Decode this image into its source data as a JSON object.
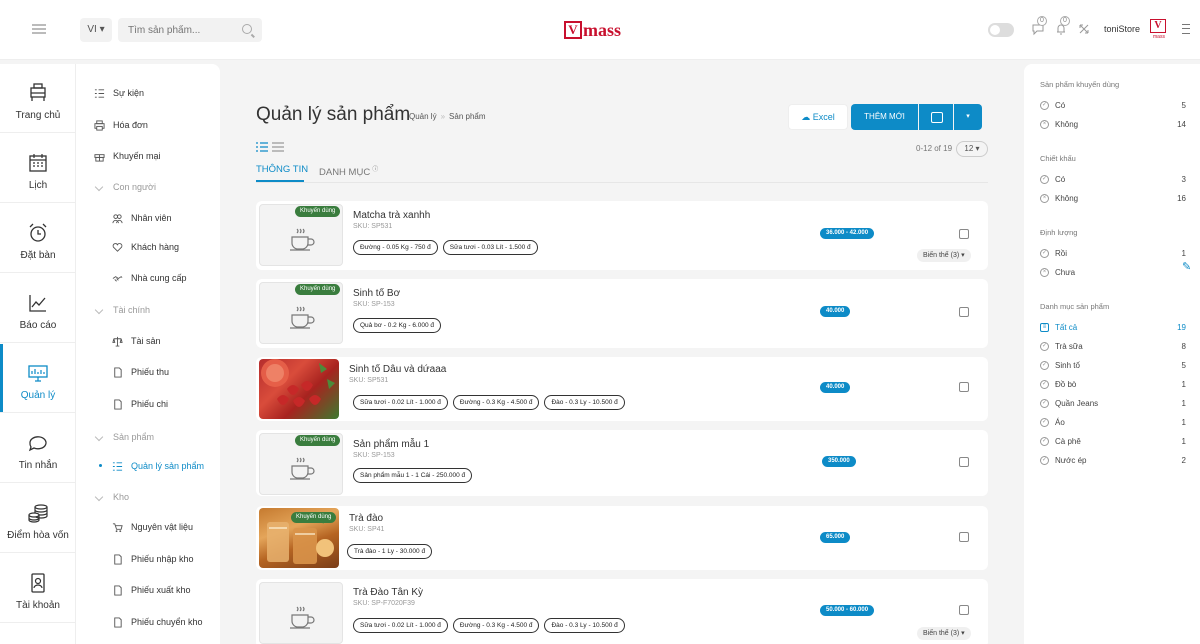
{
  "topbar": {
    "lang": "VI ▾",
    "search_placeholder": "Tìm sản phẩm...",
    "logo_mark": "V",
    "logo_text": "mass",
    "notif_badge_1": "0",
    "notif_badge_2": "0",
    "store_name": "toniStore",
    "avatar_mark": "V",
    "avatar_text": "mass"
  },
  "leftnav": [
    {
      "label": "Trang chủ",
      "icon": "home-icon"
    },
    {
      "label": "Lịch",
      "icon": "calendar-icon"
    },
    {
      "label": "Đặt bàn",
      "icon": "alarm-clock-icon"
    },
    {
      "label": "Báo cáo",
      "icon": "chart-icon"
    },
    {
      "label": "Quản lý",
      "icon": "monitor-icon"
    },
    {
      "label": "Tin nhắn",
      "icon": "chat-icon"
    },
    {
      "label": "Điểm hòa vốn",
      "icon": "coins-icon"
    },
    {
      "label": "Tài khoản",
      "icon": "account-icon"
    }
  ],
  "subnav": {
    "su_kien": "Sự kiện",
    "hoa_don": "Hóa đơn",
    "khuyen_mai": "Khuyến mại",
    "con_nguoi": "Con người",
    "nhan_vien": "Nhân viên",
    "khach_hang": "Khách hàng",
    "nha_cung_cap": "Nhà cung cấp",
    "tai_chinh": "Tài chính",
    "tai_san": "Tài sản",
    "phieu_thu": "Phiếu thu",
    "phieu_chi": "Phiếu chi",
    "san_pham": "Sản phẩm",
    "quan_ly_san_pham": "Quản lý sản phẩm",
    "kho": "Kho",
    "nguyen_vat_lieu": "Nguyên vật liệu",
    "phieu_nhap_kho": "Phiếu nhập kho",
    "phieu_xuat_kho": "Phiếu xuất kho",
    "phieu_chuyen_kho": "Phiếu chuyển kho"
  },
  "main": {
    "title": "Quản lý sản phẩm",
    "breadcrumb": [
      "Quản lý",
      "Sản phẩm"
    ],
    "excel_label": "Excel",
    "add_label": "THÊM MỚI",
    "dropdown_caret": "▾",
    "page_info": "0-12 of 19",
    "page_size": "12 ▾",
    "tabs": [
      "THÔNG TIN",
      "DANH MỤC"
    ],
    "tab2_sup": "ⓘ"
  },
  "products": [
    {
      "name": "Matcha trà xanhh",
      "sku": "SKU: SP531",
      "promo": "Khuyến dùng",
      "chips": [
        "Đường - 0.05 Kg - 750 đ",
        "Sữa tươi - 0.03 Lít - 1.500 đ"
      ],
      "price": "36.000 - 42.000",
      "variant": "Biến thể (3) ▾"
    },
    {
      "name": "Sinh tố Bơ",
      "sku": "SKU: SP-153",
      "promo": "Khuyến dùng",
      "chips": [
        "Quả bơ - 0.2 Kg - 6.000 đ"
      ],
      "price": "40.000",
      "variant": ""
    },
    {
      "name": "Sinh tố Dâu và dứaaa",
      "sku": "SKU: SP531",
      "promo": "",
      "chips": [
        "Sữa tươi - 0.02 Lít - 1.000 đ",
        "Đường - 0.3 Kg - 4.500 đ",
        "Đào - 0.3 Ly - 10.500 đ"
      ],
      "price": "40.000",
      "variant": ""
    },
    {
      "name": "Sản phẩm mẫu 1",
      "sku": "SKU: SP-153",
      "promo": "Khuyến dùng",
      "chips": [
        "Sản phẩm mẫu 1 - 1 Cái - 250.000 đ"
      ],
      "price": "350.000",
      "variant": ""
    },
    {
      "name": "Trà đào",
      "sku": "SKU: SP41",
      "promo": "Khuyến dùng",
      "chips": [
        "Trà đào - 1 Ly - 30.000 đ"
      ],
      "price": "65.000",
      "variant": ""
    },
    {
      "name": "Trà Đào Tân Kỳ",
      "sku": "SKU: SP-F7020F39",
      "promo": "",
      "chips": [
        "Sữa tươi - 0.02 Lít - 1.000 đ",
        "Đường - 0.3 Kg - 4.500 đ",
        "Đào - 0.3 Ly - 10.500 đ"
      ],
      "price": "50.000 - 60.000",
      "variant": "Biến thể (3) ▾"
    }
  ],
  "filters": {
    "sec1": "Sản phẩm khuyến dùng",
    "sec1_rows": [
      {
        "label": "Có",
        "count": "5"
      },
      {
        "label": "Không",
        "count": "14"
      }
    ],
    "sec2": "Chiết khấu",
    "sec2_rows": [
      {
        "label": "Có",
        "count": "3"
      },
      {
        "label": "Không",
        "count": "16"
      }
    ],
    "sec3": "Định lượng",
    "sec3_rows": [
      {
        "label": "Rồi",
        "count": "1"
      },
      {
        "label": "Chưa",
        "count": ""
      }
    ],
    "sec4": "Danh mục sản phẩm",
    "sec4_rows": [
      {
        "label": "Tất cả",
        "count": "19"
      },
      {
        "label": "Trà sữa",
        "count": "8"
      },
      {
        "label": "Sinh tố",
        "count": "5"
      },
      {
        "label": "Đồ bò",
        "count": "1"
      },
      {
        "label": "Quần Jeans",
        "count": "1"
      },
      {
        "label": "Áo",
        "count": "1"
      },
      {
        "label": "Cà phê",
        "count": "1"
      },
      {
        "label": "Nước ép",
        "count": "2"
      }
    ]
  },
  "colors": {
    "accent": "#0d8bc7",
    "brand": "#c8102e",
    "promo": "#3a7d3e"
  }
}
